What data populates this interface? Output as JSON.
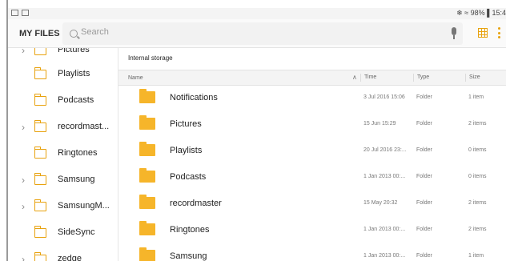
{
  "status_bar": {
    "right": "❄ ≈ 98% ▌15:4"
  },
  "header": {
    "title": "MY FILES",
    "search_placeholder": "Search"
  },
  "icons": {
    "search": "search-icon",
    "mic": "microphone-icon",
    "grid": "grid-view-icon",
    "more": "more-options-icon",
    "folder": "folder-icon"
  },
  "colors": {
    "accent": "#e8a20e",
    "folder_fill": "#f6b52a"
  },
  "sidebar": {
    "items": [
      {
        "label": "Pictures",
        "chevron": "›"
      },
      {
        "label": "Playlists",
        "chevron": ""
      },
      {
        "label": "Podcasts",
        "chevron": ""
      },
      {
        "label": "recordmast...",
        "chevron": "›"
      },
      {
        "label": "Ringtones",
        "chevron": ""
      },
      {
        "label": "Samsung",
        "chevron": "›"
      },
      {
        "label": "SamsungM...",
        "chevron": "›"
      },
      {
        "label": "SideSync",
        "chevron": ""
      },
      {
        "label": "zedge",
        "chevron": "›"
      }
    ]
  },
  "main": {
    "location": "Internal storage",
    "columns": {
      "name": "Name",
      "sort_arrow": "∧",
      "time": "Time",
      "type": "Type",
      "size": "Size"
    },
    "rows": [
      {
        "name": "Notifications",
        "time": "3 Jul 2016 15:06",
        "type": "Folder",
        "size": "1 item"
      },
      {
        "name": "Pictures",
        "time": "15 Jun 15:29",
        "type": "Folder",
        "size": "2 items"
      },
      {
        "name": "Playlists",
        "time": "20 Jul 2016 23:...",
        "type": "Folder",
        "size": "0 items"
      },
      {
        "name": "Podcasts",
        "time": "1 Jan 2013 00:...",
        "type": "Folder",
        "size": "0 items"
      },
      {
        "name": "recordmaster",
        "time": "15 May 20:32",
        "type": "Folder",
        "size": "2 items"
      },
      {
        "name": "Ringtones",
        "time": "1 Jan 2013 00:...",
        "type": "Folder",
        "size": "2 items"
      },
      {
        "name": "Samsung",
        "time": "1 Jan 2013 00:...",
        "type": "Folder",
        "size": "1 item"
      }
    ]
  }
}
